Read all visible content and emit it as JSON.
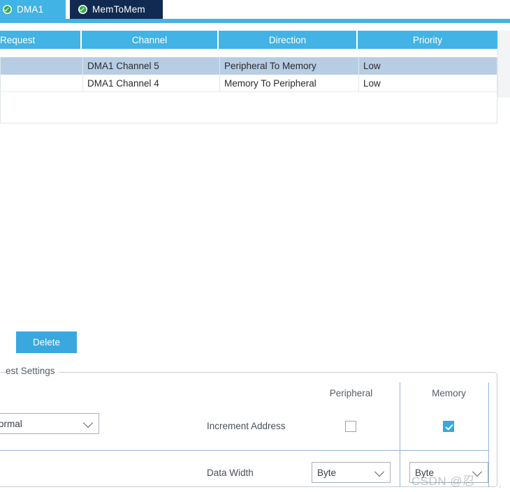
{
  "tabs": [
    {
      "label": "DMA1",
      "icon": "check-circle-icon",
      "selected": false
    },
    {
      "label": "MemToMem",
      "icon": "check-circle-icon",
      "selected": true
    }
  ],
  "table": {
    "columns": [
      "Request",
      "Channel",
      "Direction",
      "Priority"
    ],
    "rows": [
      {
        "request": "",
        "channel": "DMA1 Channel 5",
        "direction": "Peripheral To Memory",
        "priority": "Low",
        "selected": true
      },
      {
        "request": "",
        "channel": "DMA1 Channel 4",
        "direction": "Memory To Peripheral",
        "priority": "Low",
        "selected": false
      }
    ]
  },
  "buttons": {
    "delete_label": "Delete"
  },
  "settings": {
    "legend": "est Settings",
    "columns": {
      "peripheral": "Peripheral",
      "memory": "Memory"
    },
    "mode_select_value": "ormal",
    "rows": [
      {
        "label": "Increment Address",
        "peripheral_checked": false,
        "memory_checked": true
      },
      {
        "label": "Data Width",
        "peripheral_value": "Byte",
        "memory_value": "Byte"
      }
    ]
  },
  "watermark": {
    "text": "CSDN @忍",
    "dot": "。"
  },
  "colors": {
    "tab_active": "#102a52",
    "tab_inactive": "#42b3e5",
    "header_blue": "#42b3e5",
    "row_selected": "#b6cde4",
    "button_blue": "#3aa8de",
    "checkbox_on": "#35a9e0"
  }
}
